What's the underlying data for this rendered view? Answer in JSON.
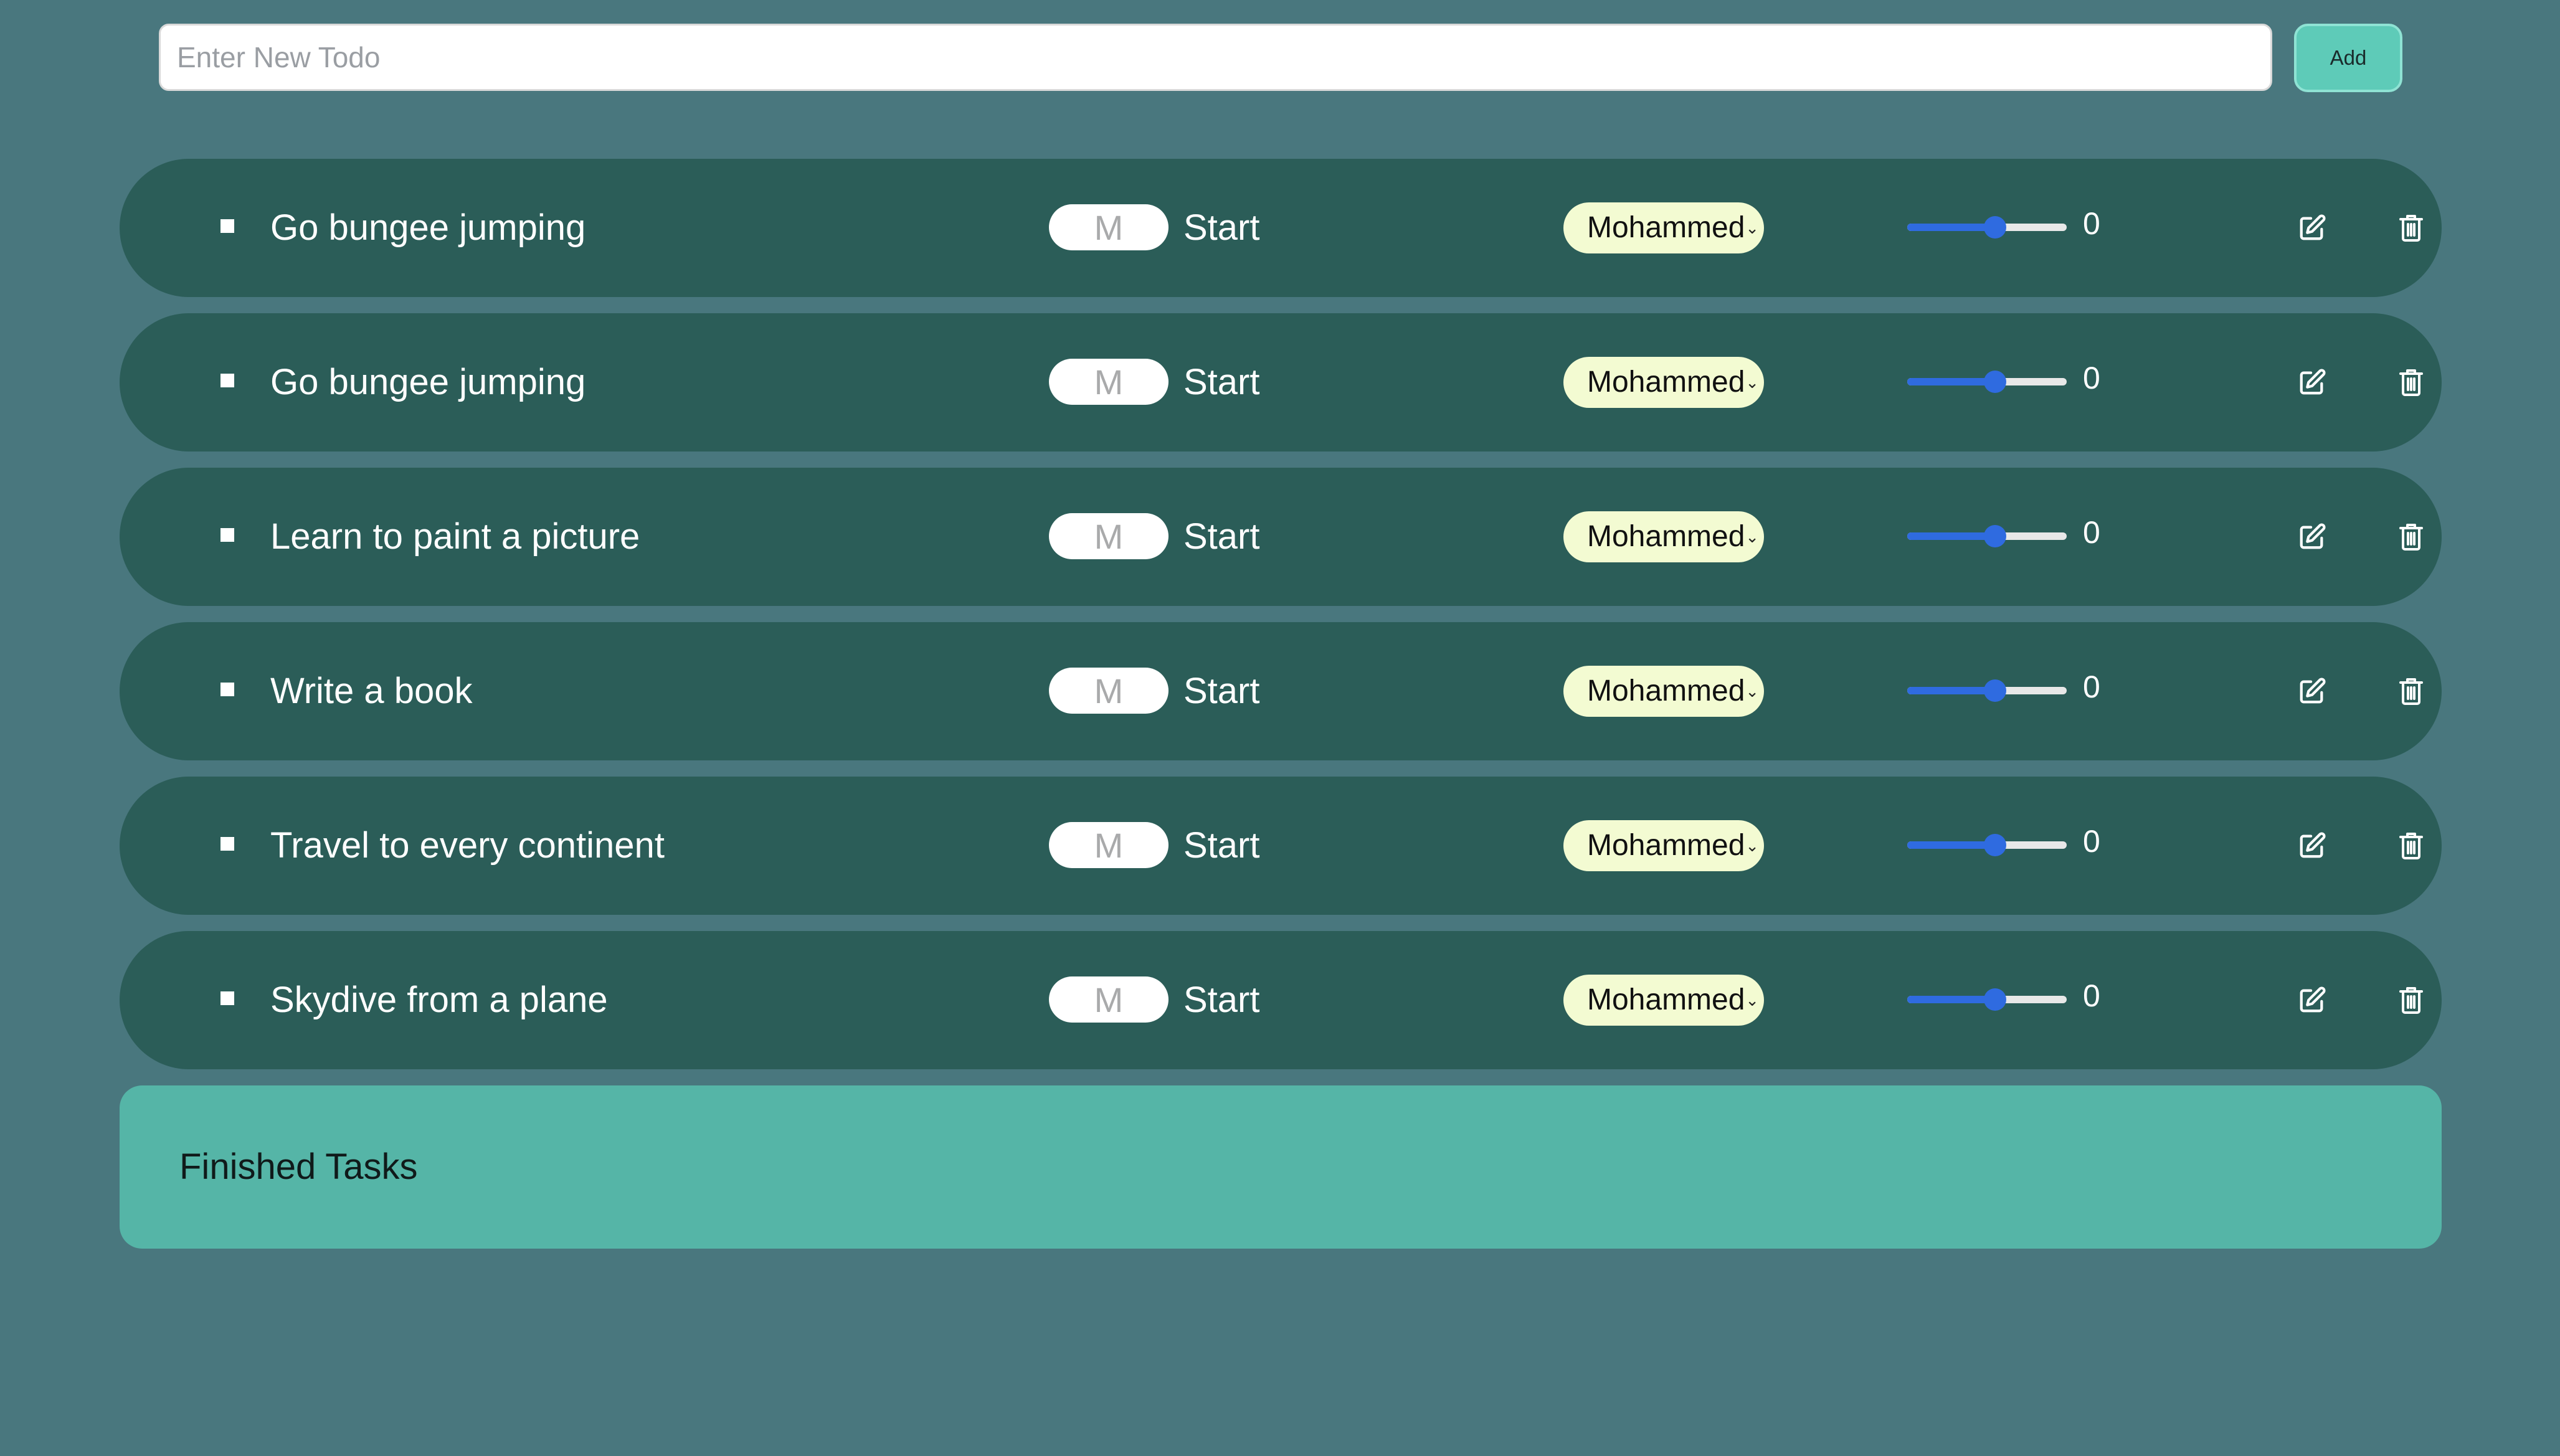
{
  "new_todo": {
    "placeholder": "Enter New Todo",
    "value": ""
  },
  "add_button": {
    "label": "Add"
  },
  "todos": [
    {
      "title": "Go bungee jumping",
      "time_value": "M",
      "start_label": "Start",
      "assignee": "Mohammed",
      "progress": 0.55,
      "value": "0"
    },
    {
      "title": "Go bungee jumping",
      "time_value": "M",
      "start_label": "Start",
      "assignee": "Mohammed",
      "progress": 0.55,
      "value": "0"
    },
    {
      "title": "Learn to paint a picture",
      "time_value": "M",
      "start_label": "Start",
      "assignee": "Mohammed",
      "progress": 0.55,
      "value": "0"
    },
    {
      "title": "Write a book",
      "time_value": "M",
      "start_label": "Start",
      "assignee": "Mohammed",
      "progress": 0.55,
      "value": "0"
    },
    {
      "title": "Travel to every continent",
      "time_value": "M",
      "start_label": "Start",
      "assignee": "Mohammed",
      "progress": 0.55,
      "value": "0"
    },
    {
      "title": "Skydive from a plane",
      "time_value": "M",
      "start_label": "Start",
      "assignee": "Mohammed",
      "progress": 0.55,
      "value": "0"
    }
  ],
  "finished_section": {
    "title": "Finished Tasks"
  },
  "icons": {
    "edit": "edit-icon",
    "delete": "trash-icon",
    "chevron": "chevron-down-icon",
    "bullet": "square-bullet-icon"
  },
  "colors": {
    "background": "#49777e",
    "row": "#2b5d58",
    "accent": "#5ecbb8",
    "finished": "#55b5a7",
    "slider": "#2f6be0",
    "assignee_bg": "#f3fbd2"
  }
}
